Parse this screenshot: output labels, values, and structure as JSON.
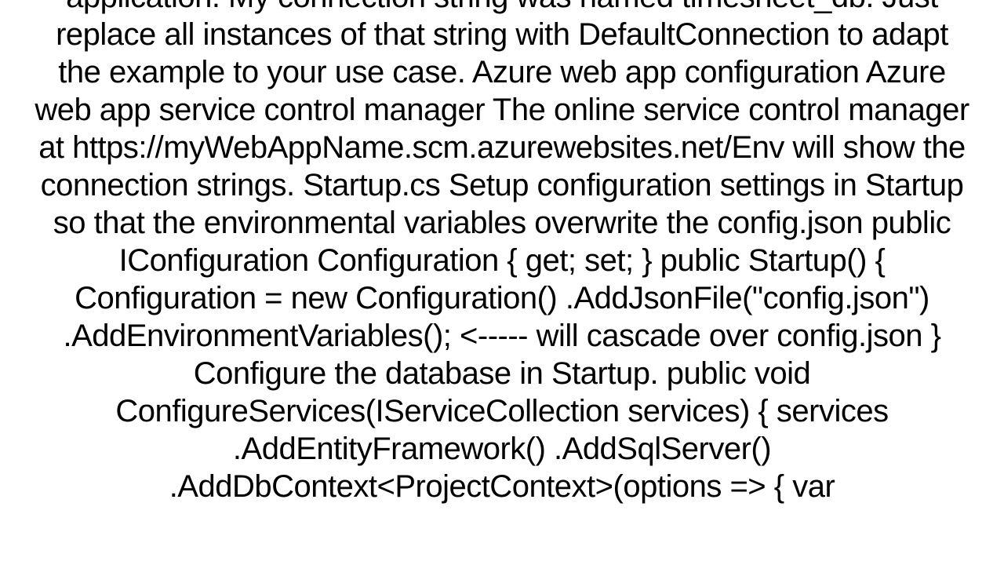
{
  "document": {
    "body_text": "application. My connection string was named timesheet_db. Just replace all instances of that string with DefaultConnection to adapt the example to your use case.  Azure web app configuration  Azure web app service control manager The online service control manager at https://myWebAppName.scm.azurewebsites.net/Env will show the connection strings.  Startup.cs Setup configuration settings in Startup so that the environmental variables overwrite the config.json public IConfiguration Configuration { get; set; } public Startup() {  Configuration = new Configuration()     .AddJsonFile(\"config.json\")     .AddEnvironmentVariables();    <----- will cascade over config.json }  Configure the database in Startup. public void ConfigureServices(IServiceCollection services)  {   services     .AddEntityFramework()     .AddSqlServer()     .AddDbContext<ProjectContext>(options =>     {       var"
  }
}
